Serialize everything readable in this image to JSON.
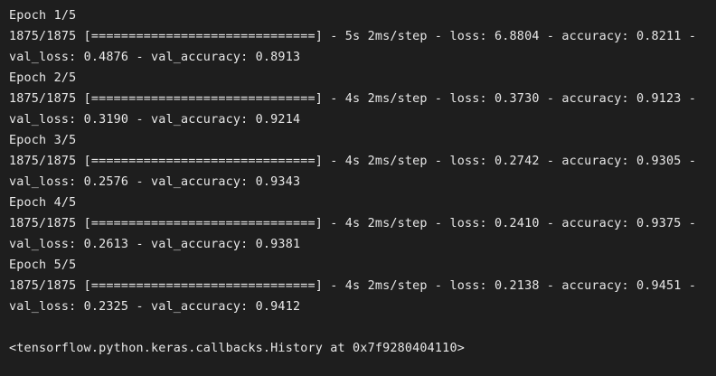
{
  "output": {
    "epochs": [
      {
        "header": "Epoch 1/5",
        "progress": "1875/1875 [==============================] - 5s 2ms/step - loss: 6.8804 - accuracy: 0.8211 -",
        "validation": "val_loss: 0.4876 - val_accuracy: 0.8913"
      },
      {
        "header": "Epoch 2/5",
        "progress": "1875/1875 [==============================] - 4s 2ms/step - loss: 0.3730 - accuracy: 0.9123 -",
        "validation": "val_loss: 0.3190 - val_accuracy: 0.9214"
      },
      {
        "header": "Epoch 3/5",
        "progress": "1875/1875 [==============================] - 4s 2ms/step - loss: 0.2742 - accuracy: 0.9305 -",
        "validation": "val_loss: 0.2576 - val_accuracy: 0.9343"
      },
      {
        "header": "Epoch 4/5",
        "progress": "1875/1875 [==============================] - 4s 2ms/step - loss: 0.2410 - accuracy: 0.9375 -",
        "validation": "val_loss: 0.2613 - val_accuracy: 0.9381"
      },
      {
        "header": "Epoch 5/5",
        "progress": "1875/1875 [==============================] - 4s 2ms/step - loss: 0.2138 - accuracy: 0.9451 -",
        "validation": "val_loss: 0.2325 - val_accuracy: 0.9412"
      }
    ],
    "result": "<tensorflow.python.keras.callbacks.History at 0x7f9280404110>"
  },
  "colors": {
    "background": "#1e1e1e",
    "text": "#e8e8e8"
  }
}
